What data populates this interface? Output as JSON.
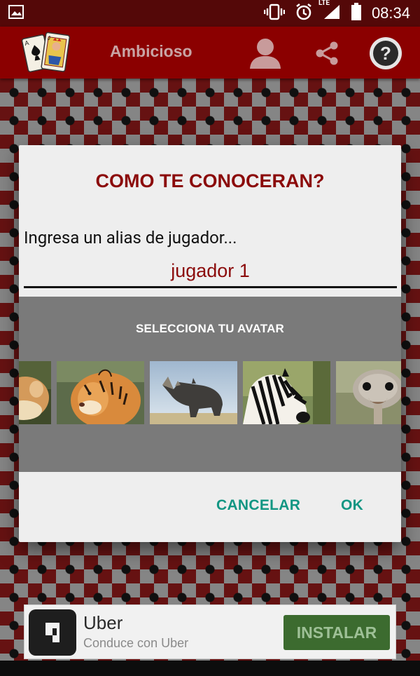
{
  "status_bar": {
    "time": "08:34",
    "network_label": "LTE",
    "icons": [
      "image-icon",
      "vibrate-icon",
      "alarm-icon",
      "signal-icon",
      "battery-icon"
    ]
  },
  "app_bar": {
    "title": "Ambicioso",
    "actions": [
      "profile-icon",
      "share-icon",
      "help-icon"
    ],
    "help_symbol": "?"
  },
  "dialog": {
    "title": "COMO TE CONOCERAN?",
    "prompt": "Ingresa un alias de jugador...",
    "alias_value": "jugador 1",
    "avatar_section_title": "SELECCIONA TU AVATAR",
    "avatars": [
      "cat",
      "tiger",
      "rhino",
      "zebra",
      "ostrich"
    ],
    "cancel_label": "CANCELAR",
    "ok_label": "OK"
  },
  "ad": {
    "app_name": "Uber",
    "tagline": "Conduce con Uber",
    "install_label": "INSTALAR"
  },
  "colors": {
    "status_bar": "#540808",
    "app_bar": "#8b0000",
    "title_red": "#8b0a0a",
    "accent_teal": "#129683",
    "avatar_panel": "#7a7a7a",
    "install_green": "#3c6b2f"
  }
}
